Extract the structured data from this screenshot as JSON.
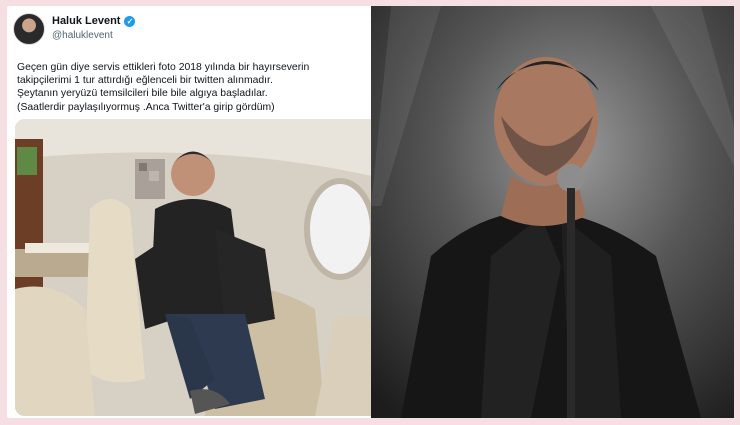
{
  "tweet": {
    "display_name": "Haluk Levent",
    "verified_icon": "verified-badge-icon",
    "handle": "@haluklevent",
    "menu_icon": "close-icon",
    "lines": [
      "Geçen gün diye servis ettikleri foto 2018 yılında bir hayırseverin",
      "takipçilerimi 1 tur attırdığı eğlenceli bir twitten alınmadır.",
      "Şeytanın yeryüzü temsilcileri bile bile algıya başladılar.",
      "(Saatlerdir paylaşılıyormuş .Anca Twitter'a girip gördüm)"
    ]
  },
  "colors": {
    "background": "#f6dfe3",
    "verified_blue": "#1d9bf0",
    "text_primary": "#0f1419",
    "text_secondary": "#536471"
  }
}
